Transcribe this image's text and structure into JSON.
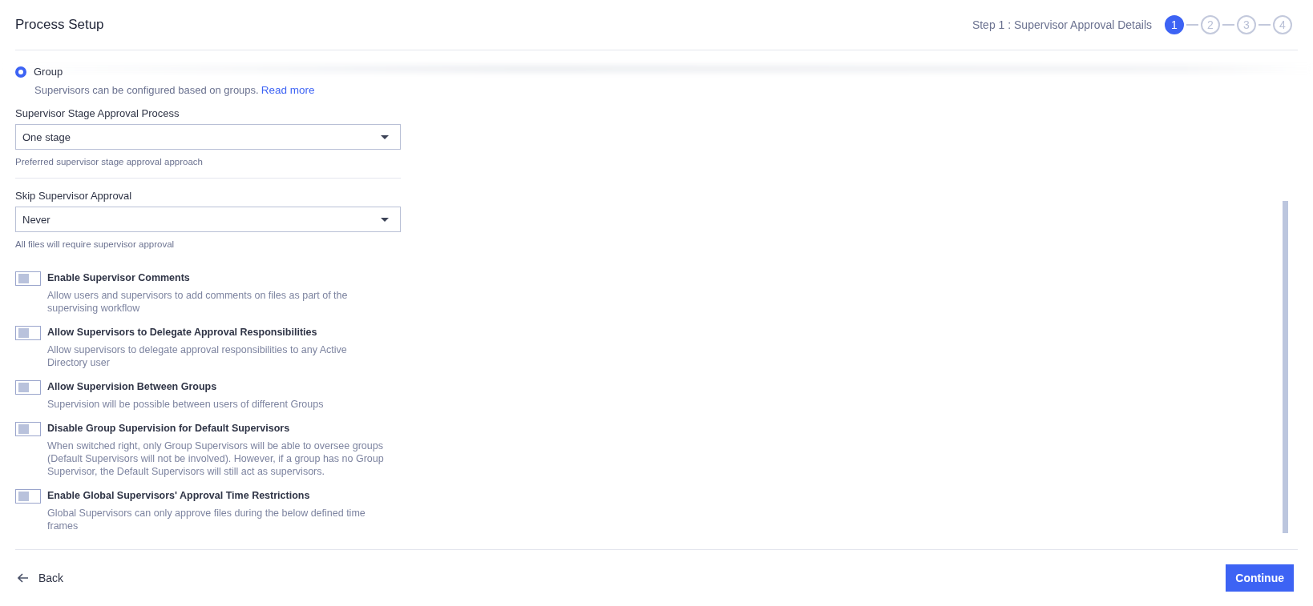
{
  "header": {
    "title": "Process Setup",
    "step_caption": "Step 1 : Supervisor Approval Details",
    "steps": [
      {
        "label": "1",
        "selected": true
      },
      {
        "label": "2",
        "selected": false
      },
      {
        "label": "3",
        "selected": false
      },
      {
        "label": "4",
        "selected": false
      }
    ]
  },
  "radio": {
    "label": "Group",
    "selected": true,
    "description": "Supervisors can be configured based on groups.",
    "link": "Read more"
  },
  "selects": [
    {
      "label": "Supervisor Stage Approval Process",
      "value": "One stage",
      "hint": "Preferred supervisor stage approval approach"
    },
    {
      "label": "Skip Supervisor Approval",
      "value": "Never",
      "hint": "All files will require supervisor approval"
    }
  ],
  "toggles": [
    {
      "label": "Enable Supervisor Comments",
      "on": false,
      "description": "Allow users and supervisors to add comments on files as part of the supervising workflow"
    },
    {
      "label": "Allow Supervisors to Delegate Approval Responsibilities",
      "on": false,
      "description": "Allow supervisors to delegate approval responsibilities to any Active Directory user"
    },
    {
      "label": "Allow Supervision Between Groups",
      "on": false,
      "description": "Supervision will be possible between users of different Groups"
    },
    {
      "label": "Disable Group Supervision for Default Supervisors",
      "on": false,
      "description": "When switched right, only Group Supervisors will be able to oversee groups (Default Supervisors will not be involved). However, if a group has no Group Supervisor, the Default Supervisors will still act as supervisors."
    },
    {
      "label": "Enable Global Supervisors' Approval Time Restrictions",
      "on": false,
      "description": "Global Supervisors can only approve files during the below defined time frames"
    }
  ],
  "footer": {
    "back": "Back",
    "continue": "Continue"
  }
}
